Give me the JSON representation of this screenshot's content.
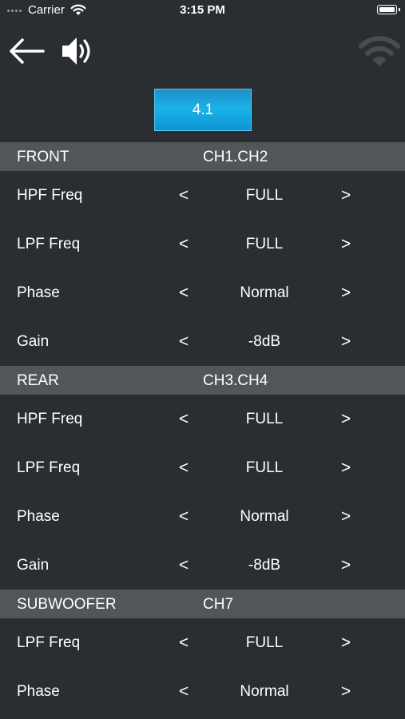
{
  "status_bar": {
    "carrier": "Carrier",
    "time": "3:15 PM"
  },
  "toolbar": {
    "back_icon": "arrow-left-icon",
    "speaker_icon": "speaker-volume-icon",
    "connection_icon": "wifi-disconnected-icon"
  },
  "mode": {
    "label": "4.1",
    "color": "#1ab2e8"
  },
  "colors": {
    "background": "#2a2d31",
    "section_header": "#535659",
    "text": "#ffffff"
  },
  "sections": [
    {
      "name": "FRONT",
      "channels": "CH1.CH2",
      "rows": [
        {
          "label": "HPF Freq",
          "dec": "<",
          "value": "FULL",
          "inc": ">"
        },
        {
          "label": "LPF Freq",
          "dec": "<",
          "value": "FULL",
          "inc": ">"
        },
        {
          "label": "Phase",
          "dec": "<",
          "value": "Normal",
          "inc": ">"
        },
        {
          "label": "Gain",
          "dec": "<",
          "value": "-8dB",
          "inc": ">"
        }
      ]
    },
    {
      "name": "REAR",
      "channels": "CH3.CH4",
      "rows": [
        {
          "label": "HPF Freq",
          "dec": "<",
          "value": "FULL",
          "inc": ">"
        },
        {
          "label": "LPF Freq",
          "dec": "<",
          "value": "FULL",
          "inc": ">"
        },
        {
          "label": "Phase",
          "dec": "<",
          "value": "Normal",
          "inc": ">"
        },
        {
          "label": "Gain",
          "dec": "<",
          "value": "-8dB",
          "inc": ">"
        }
      ]
    },
    {
      "name": "SUBWOOFER",
      "channels": "CH7",
      "rows": [
        {
          "label": "LPF Freq",
          "dec": "<",
          "value": "FULL",
          "inc": ">"
        },
        {
          "label": "Phase",
          "dec": "<",
          "value": "Normal",
          "inc": ">"
        }
      ]
    }
  ]
}
